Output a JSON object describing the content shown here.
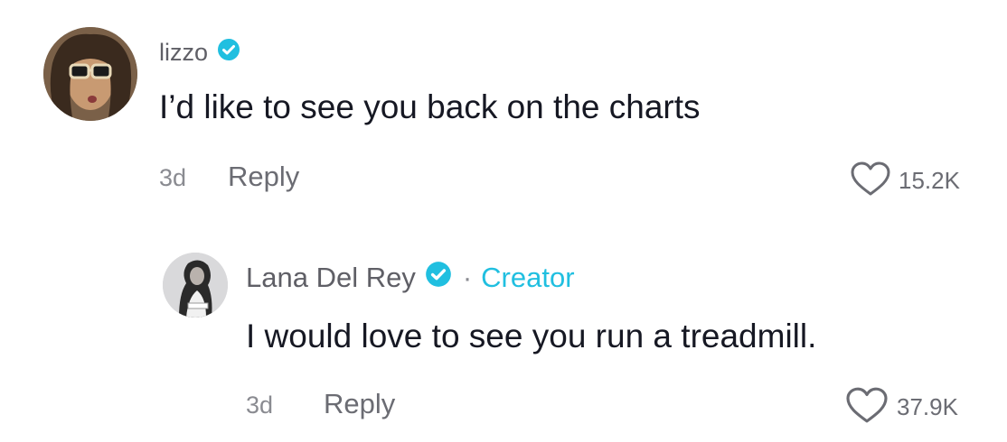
{
  "comments": [
    {
      "username": "lizzo",
      "verified_icon": "verified-badge-icon",
      "text": "I’d like to see you back on the charts",
      "time": "3d",
      "reply_label": "Reply",
      "like_icon": "heart-outline-icon",
      "like_count": "15.2K"
    }
  ],
  "replies": [
    {
      "username": "Lana Del Rey",
      "verified_icon": "verified-badge-icon",
      "separator": "·",
      "role_label": "Creator",
      "text": "I would love to see you run a treadmill.",
      "time": "3d",
      "reply_label": "Reply",
      "like_icon": "heart-outline-icon",
      "like_count": "37.9K"
    }
  ],
  "colors": {
    "verified": "#20bfe0",
    "creator": "#20bfe0",
    "muted": "#8a8b91",
    "text": "#161823"
  }
}
